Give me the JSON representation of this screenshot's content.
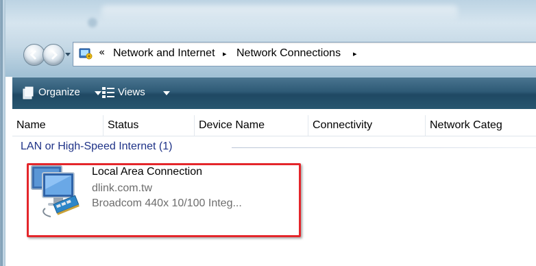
{
  "address_bar": {
    "overflow_glyph": "«",
    "crumbs": [
      "Network and Internet",
      "Network Connections"
    ],
    "separator_glyph": "▸"
  },
  "toolbar": {
    "organize_label": "Organize",
    "views_label": "Views"
  },
  "columns": {
    "name": "Name",
    "status": "Status",
    "device_name": "Device Name",
    "connectivity": "Connectivity",
    "network_category": "Network Categ"
  },
  "group": {
    "title": "LAN or High-Speed Internet (1)"
  },
  "connection": {
    "name": "Local Area Connection",
    "network": "dlink.com.tw",
    "device": "Broadcom 440x 10/100 Integ..."
  },
  "icons": {
    "back": "back-arrow-icon",
    "forward": "forward-arrow-icon",
    "organize": "organize-icon",
    "views": "views-icon",
    "address": "network-folder-icon",
    "connection": "network-adapter-icon"
  },
  "colors": {
    "toolbar": "#2e5a76",
    "group_title": "#1e3287",
    "highlight": "#e4262b",
    "secondary_text": "#6d6d6d"
  }
}
